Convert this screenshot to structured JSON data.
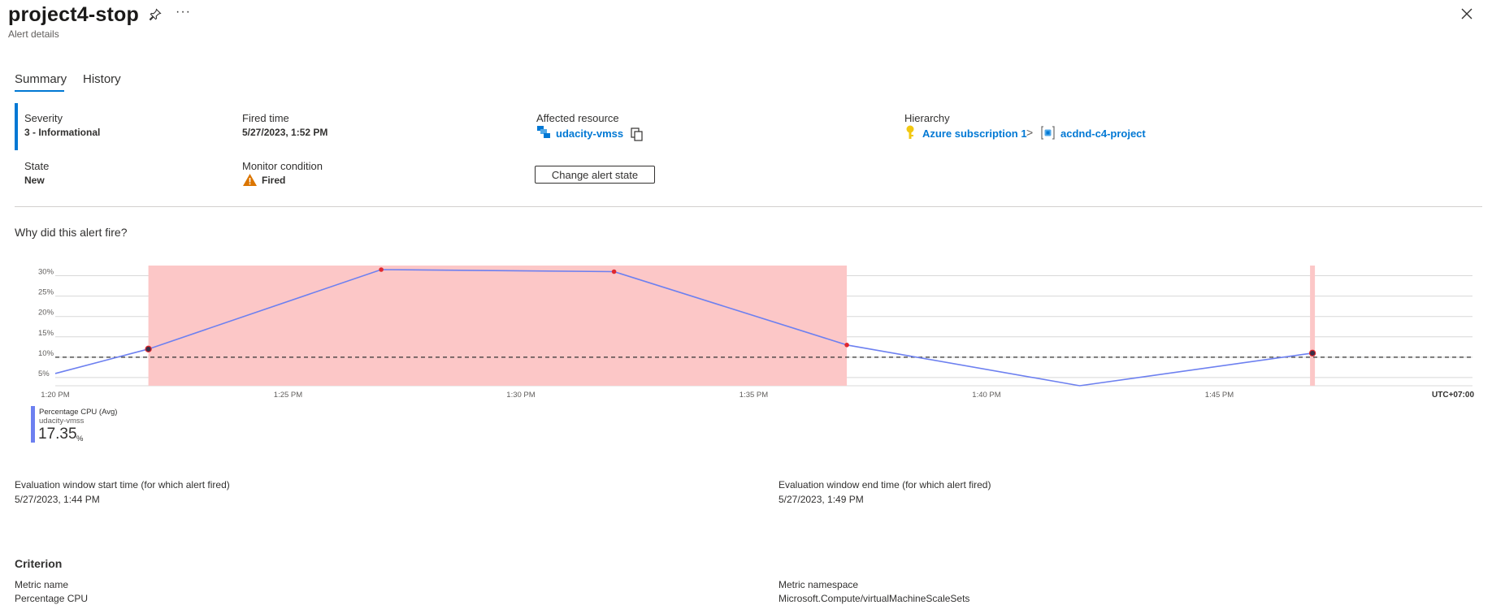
{
  "header": {
    "title": "project4-stop",
    "subtitle": "Alert details",
    "pin_icon": "pin-icon",
    "more_icon": "more-icon",
    "more_glyph": "···",
    "close_icon": "close-icon"
  },
  "tabs": [
    {
      "label": "Summary",
      "selected": true
    },
    {
      "label": "History",
      "selected": false
    }
  ],
  "summary": {
    "severity_label": "Severity",
    "severity_value": "3 - Informational",
    "fired_time_label": "Fired time",
    "fired_time_value": "5/27/2023, 1:52 PM",
    "affected_resource_label": "Affected resource",
    "affected_resource_value": "udacity-vmss",
    "hierarchy_label": "Hierarchy",
    "hierarchy_subscription": "Azure subscription 1",
    "hierarchy_separator": ">",
    "hierarchy_resource_group": "acdnd-c4-project",
    "state_label": "State",
    "state_value": "New",
    "monitor_condition_label": "Monitor condition",
    "monitor_condition_value": "Fired",
    "change_state_button": "Change alert state"
  },
  "why_title": "Why did this alert fire?",
  "chart_data": {
    "type": "line",
    "title": "",
    "xlabel": "",
    "ylabel": "",
    "x_ticks": [
      "1:20 PM",
      "1:25 PM",
      "1:30 PM",
      "1:35 PM",
      "1:40 PM",
      "1:45 PM"
    ],
    "y_ticks": [
      "5%",
      "10%",
      "15%",
      "20%",
      "25%",
      "30%"
    ],
    "timezone": "UTC+07:00",
    "ylim": [
      1,
      31.5
    ],
    "threshold": 10,
    "series": [
      {
        "name": "",
        "x": [
          "1:20 PM",
          "1:22 PM",
          "1:27 PM",
          "1:32 PM",
          "1:37 PM",
          "1:42 PM",
          "1:47 PM"
        ],
        "y": [
          6,
          12,
          31.5,
          31,
          13,
          1,
          11
        ]
      }
    ],
    "alert_regions": [
      {
        "start": "1:22 PM",
        "end": "1:37 PM"
      },
      {
        "start": "1:47 PM",
        "end": "1:47 PM"
      }
    ],
    "colors": {
      "line": "#6d80f0",
      "region": "#fcc7c7",
      "marker_fired": "#e0282f",
      "marker_dark": "#3b2e46"
    }
  },
  "legend": {
    "metric": "Percentage CPU (Avg)",
    "resource": "udacity-vmss",
    "value": "17.35",
    "unit": "%"
  },
  "evaluation": {
    "start_label": "Evaluation window start time (for which alert fired)",
    "start_value": "5/27/2023, 1:44 PM",
    "end_label": "Evaluation window end time (for which alert fired)",
    "end_value": "5/27/2023, 1:49 PM"
  },
  "criterion": {
    "title": "Criterion",
    "metric_name_label": "Metric name",
    "metric_name_value": "Percentage CPU",
    "metric_namespace_label": "Metric namespace",
    "metric_namespace_value": "Microsoft.Compute/virtualMachineScaleSets"
  }
}
